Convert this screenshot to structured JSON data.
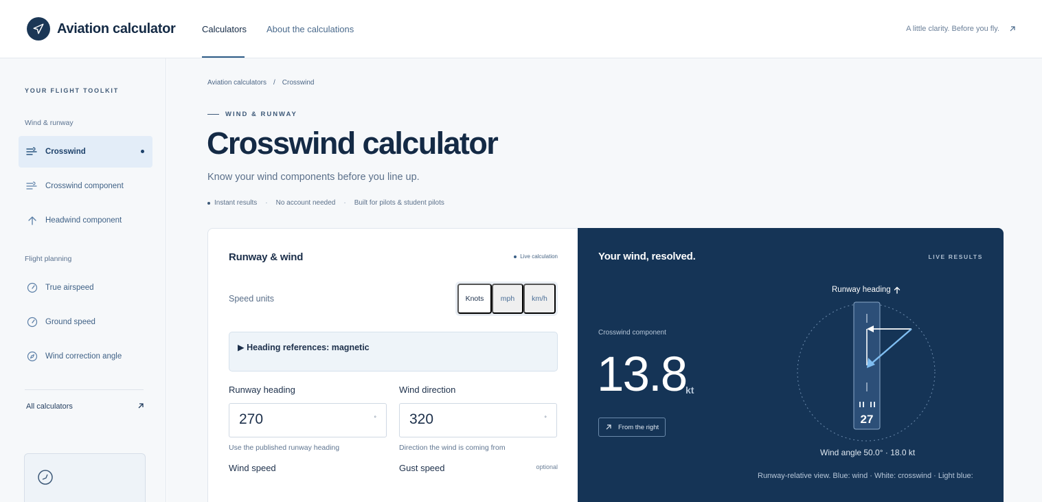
{
  "header": {
    "brand": "Aviation calculator",
    "nav": [
      "Calculators",
      "About the calculations"
    ],
    "tagline": "A little clarity. Before you fly."
  },
  "sidebar": {
    "toolkit_label": "YOUR FLIGHT TOOLKIT",
    "group_wind": "Wind & runway",
    "group_planning": "Flight planning",
    "items": [
      {
        "label": "Crosswind",
        "icon": "wind-icon",
        "active": true
      },
      {
        "label": "Crosswind component",
        "icon": "wind-icon",
        "active": false
      },
      {
        "label": "Headwind component",
        "icon": "arrow-up-icon",
        "active": false
      },
      {
        "label": "True airspeed",
        "icon": "gauge-icon",
        "active": false
      },
      {
        "label": "Ground speed",
        "icon": "gauge-icon",
        "active": false
      },
      {
        "label": "Wind correction angle",
        "icon": "compass-icon",
        "active": false
      }
    ],
    "all_calculators": "All calculators"
  },
  "main": {
    "breadcrumb": [
      "Aviation calculators",
      "/",
      "Crosswind"
    ],
    "eyebrow": "WIND & RUNWAY",
    "title": "Crosswind calculator",
    "subtitle": "Know your wind components before you line up.",
    "badges": [
      "Instant results",
      "·",
      "No account needed",
      "·",
      "Built for pilots & student pilots"
    ]
  },
  "form": {
    "title": "Runway & wind",
    "live": "Live calculation",
    "units_label": "Speed units",
    "units": [
      "Knots",
      "mph",
      "km/h"
    ],
    "selected_unit": "Knots",
    "details_summary": "▶ Heading references: magnetic",
    "runway_heading": {
      "label": "Runway heading",
      "value": "270",
      "unit": "°",
      "help": "Use the published runway heading"
    },
    "wind_direction": {
      "label": "Wind direction",
      "value": "320",
      "unit": "°",
      "help": "Direction the wind is coming from"
    },
    "wind_speed_label": "Wind speed",
    "gust_speed_label": "Gust speed",
    "optional": "optional"
  },
  "results": {
    "title": "Your wind, resolved.",
    "live": "LIVE RESULTS",
    "component_label": "Crosswind component",
    "value": "13.8",
    "unit": "kt",
    "side": "From the right",
    "runway_label": "Runway heading",
    "runway_number": "27",
    "angle": "Wind angle 50.0° · 18.0 kt",
    "footnote": "Runway-relative view. Blue: wind · White: crosswind · Light blue:"
  }
}
